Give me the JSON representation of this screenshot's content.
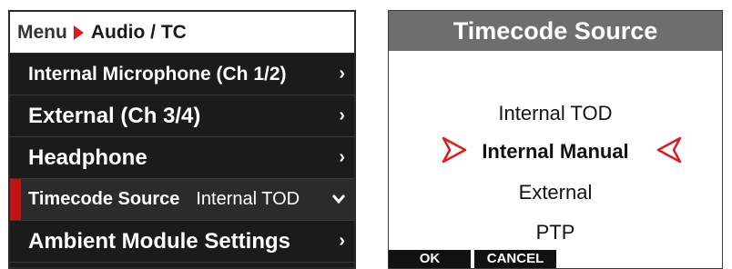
{
  "menu": {
    "breadcrumb": {
      "root": "Menu",
      "current": "Audio / TC"
    },
    "items": [
      {
        "label": "Internal Microphone (Ch 1/2)",
        "chevron": "›"
      },
      {
        "label": "External (Ch 3/4)",
        "chevron": "›"
      },
      {
        "label": "Headphone",
        "chevron": "›"
      },
      {
        "label": "Timecode Source",
        "value": "Internal TOD",
        "chevron": "⌄"
      },
      {
        "label": "Ambient Module Settings",
        "chevron": "›"
      }
    ]
  },
  "dialog": {
    "title": "Timecode Source",
    "options": [
      "Internal TOD",
      "Internal Manual",
      "External",
      "PTP"
    ],
    "selected_index": 1,
    "buttons": {
      "ok": "OK",
      "cancel": "CANCEL"
    }
  },
  "colors": {
    "accent_red": "#e01b1b",
    "menu_bg": "#1b1b1b",
    "dialog_title_bg": "#6e6e6e"
  },
  "icons": {
    "breadcrumb_separator": "right-triangle-icon",
    "submenu": "chevron-right-icon",
    "dropdown": "chevron-down-icon",
    "selection_left": "selection-arrow-right-icon",
    "selection_right": "selection-arrow-left-icon"
  }
}
